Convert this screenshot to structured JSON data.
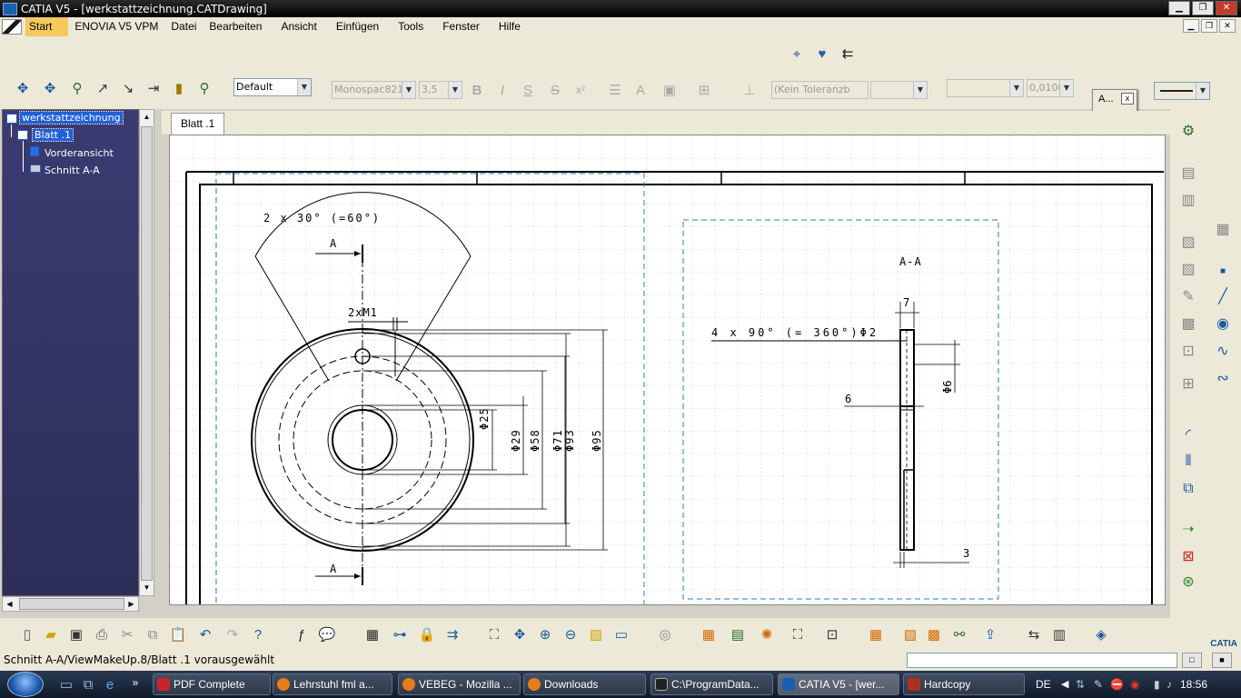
{
  "window": {
    "title": "CATIA V5 - [werkstattzeichnung.CATDrawing]"
  },
  "menu": {
    "items": [
      "Start",
      "ENOVIA V5 VPM",
      "Datei",
      "Bearbeiten",
      "Ansicht",
      "Einfügen",
      "Tools",
      "Fenster",
      "Hilfe"
    ]
  },
  "toolbar": {
    "style_value": "Default",
    "font_value": "Monospac821",
    "size_value": "3,5",
    "tolerance_value": "(Kein Toleranzb",
    "precision_value": "0,0100",
    "bold": "B",
    "italic": "I",
    "underline": "S",
    "strike": "S",
    "superscript": "x²"
  },
  "tree": {
    "root": "werkstattzeichnung",
    "sheet": "Blatt .1",
    "view1": "Vorderansicht",
    "view2": "Schnitt A-A"
  },
  "tabs": {
    "sheet_tab": "Blatt .1"
  },
  "palette": {
    "title": "A...",
    "close": "x"
  },
  "drawing": {
    "label_angle": "2 x 30° (=60°)",
    "section_a_top": "A",
    "section_a_bottom": "A",
    "label_thread": "2xM1",
    "dim_25": "Φ25",
    "dim_29": "Φ29",
    "dim_58": "Φ58",
    "dim_71": "Φ71",
    "dim_93": "Φ93",
    "dim_95": "Φ95",
    "section_title": "A-A",
    "dim_7": "7",
    "label_holes": "4 x 90° (= 360°)Φ2",
    "dim_phi6": "Φ6",
    "dim_6": "6",
    "dim_3": "3"
  },
  "status": {
    "text": "Schnitt A-A/ViewMakeUp.8/Blatt .1 vorausgewählt"
  },
  "taskbar": {
    "tasks": [
      "PDF Complete",
      "Lehrstuhl fml a...",
      "VEBEG - Mozilla ...",
      "Downloads",
      "C:\\ProgramData...",
      "CATIA V5 - [wer...",
      "Hardcopy"
    ],
    "lang": "DE",
    "time": "18:56"
  },
  "brand": {
    "logo_text": "CATIA"
  }
}
